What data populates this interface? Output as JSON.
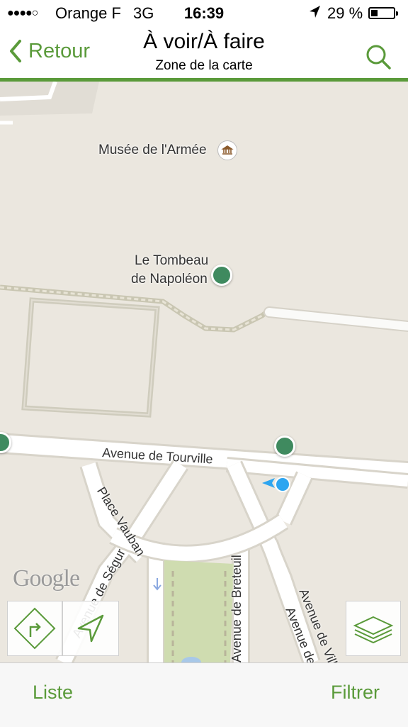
{
  "status_bar": {
    "signal": "●●●●○",
    "carrier": "Orange F",
    "network": "3G",
    "time": "16:39",
    "battery_percent": "29 %"
  },
  "nav": {
    "back_label": "Retour",
    "title": "À voir/À faire",
    "subtitle": "Zone de la carte",
    "search_icon": "search-icon"
  },
  "map": {
    "labels": {
      "musee": "Musée de l'Armée",
      "tombeau_line1": "Le Tombeau",
      "tombeau_line2": "de Napoléon",
      "tourville": "Avenue de Tourville",
      "vauban": "Place Vauban",
      "segur": "Avenue de Ségur",
      "breteuil": "Avenue de Breteuil",
      "villars": "Avenue de Villars",
      "avenue_de": "Avenue de"
    },
    "google": "Google",
    "controls": {
      "route_icon": "route-icon",
      "locate_icon": "locate-arrow-icon",
      "layers_icon": "layers-icon"
    },
    "colors": {
      "poi": "#3f8a5f",
      "road": "#ffffff",
      "background": "#ebe7df",
      "park": "#cfdcb0",
      "user": "#2da5f0"
    }
  },
  "tab_bar": {
    "left": "Liste",
    "right": "Filtrer"
  },
  "accent_color": "#5a9a3a"
}
